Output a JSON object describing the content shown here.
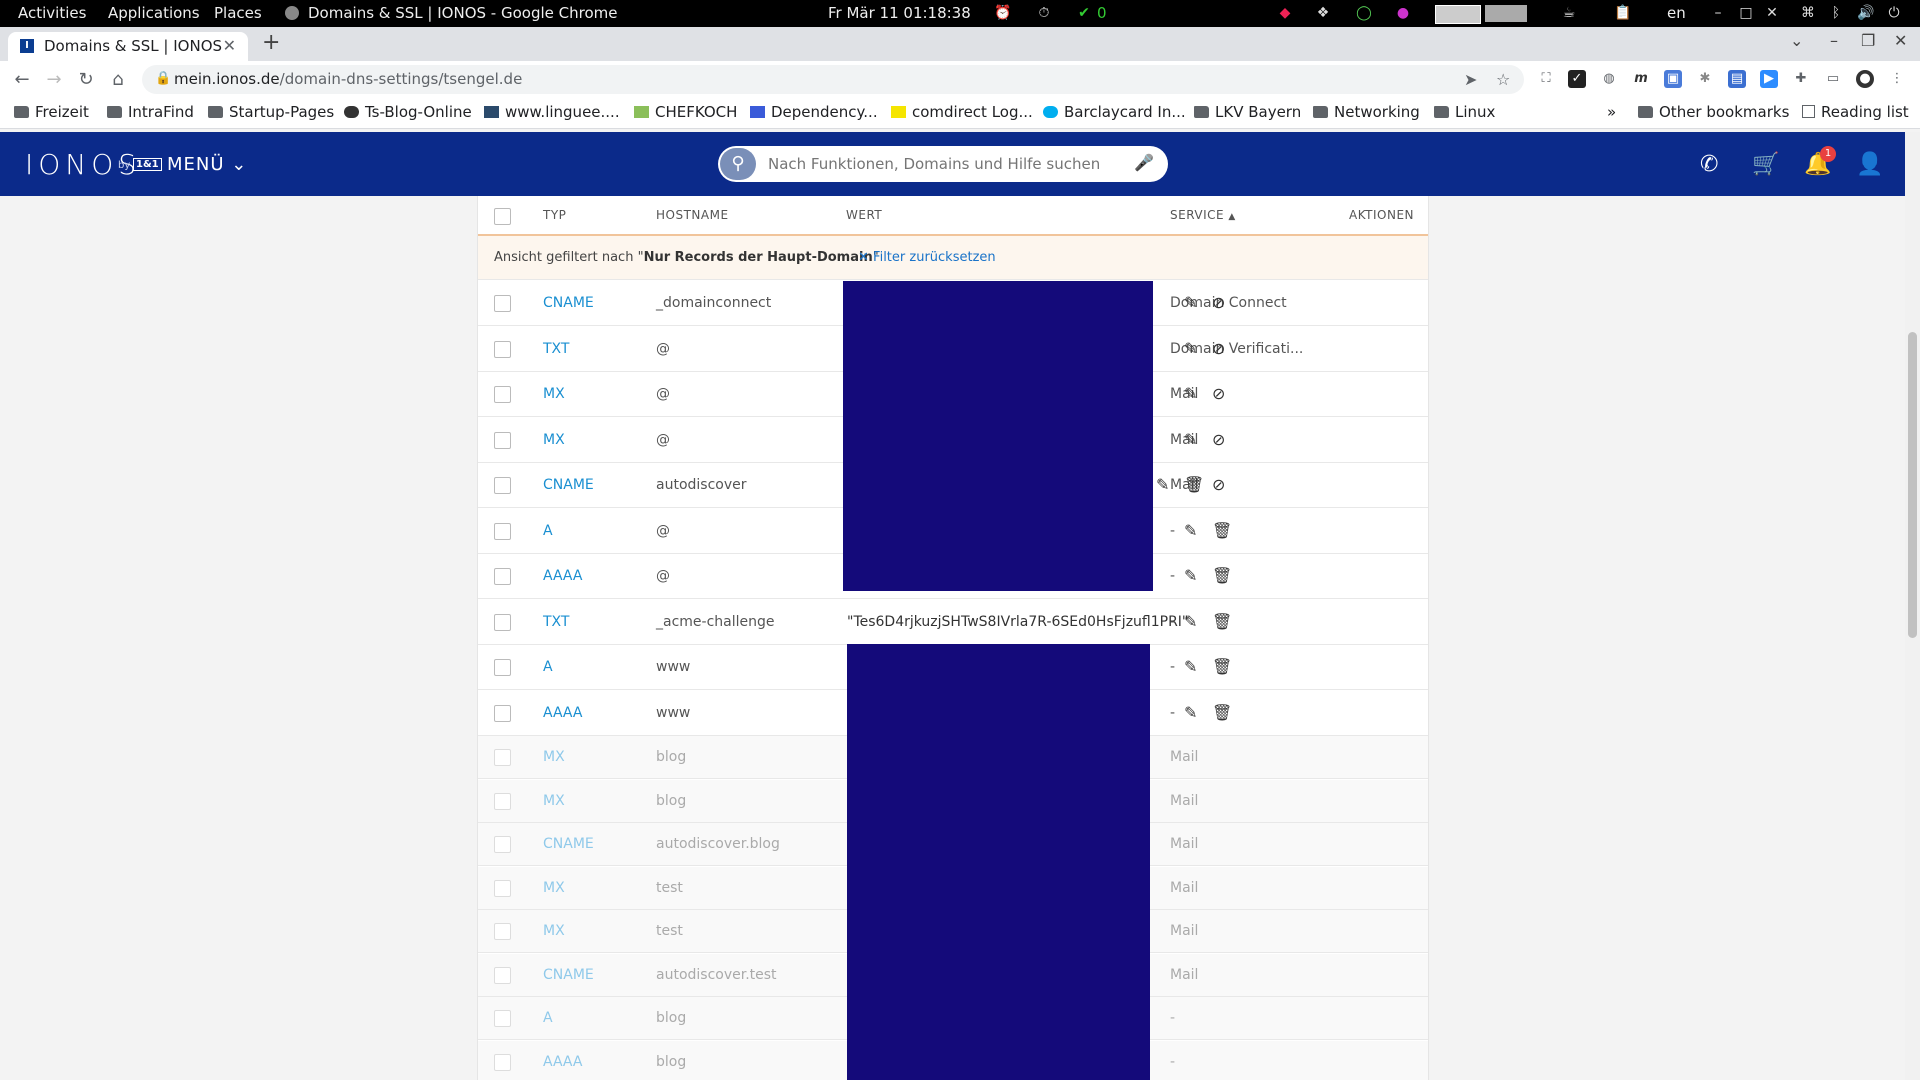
{
  "system_bar": {
    "activities": "Activities",
    "applications": "Applications",
    "places": "Places",
    "window_title": "Domains & SSL | IONOS - Google Chrome",
    "clock": "Fr Mär 11  01:18:38",
    "check_count": "0",
    "language": "en"
  },
  "browser": {
    "tab_title": "Domains & SSL | IONOS",
    "url_host": "mein.ionos.de",
    "url_path": "/domain-dns-settings/tsengel.de"
  },
  "bookmarks": [
    {
      "label": "Freizeit",
      "icon": "folder-icon"
    },
    {
      "label": "IntraFind",
      "icon": "folder-icon"
    },
    {
      "label": "Startup-Pages",
      "icon": "folder-icon"
    },
    {
      "label": "Ts-Blog-Online",
      "icon": "blog-icon"
    },
    {
      "label": "www.linguee....",
      "icon": "linguee-icon"
    },
    {
      "label": "CHEFKOCH",
      "icon": "chefkoch-icon"
    },
    {
      "label": "Dependency...",
      "icon": "dependency-icon"
    },
    {
      "label": "comdirect Log...",
      "icon": "comdirect-icon"
    },
    {
      "label": "Barclaycard In...",
      "icon": "barclaycard-icon"
    },
    {
      "label": "LKV Bayern",
      "icon": "folder-icon"
    },
    {
      "label": "Networking",
      "icon": "folder-icon"
    },
    {
      "label": "Linux",
      "icon": "folder-icon"
    }
  ],
  "bookmarks_overflow": "»",
  "other_bookmarks": "Other bookmarks",
  "reading_list": "Reading list",
  "ionos": {
    "logo": "IONOS",
    "logo_by": "by",
    "logo_brand": "1&1",
    "menu_label": "MENÜ",
    "search_placeholder": "Nach Funktionen, Domains und Hilfe suchen",
    "notification_count": "1",
    "brand_color": "#0b2a8a"
  },
  "table": {
    "headers": {
      "typ": "TYP",
      "hostname": "HOSTNAME",
      "wert": "WERT",
      "service": "SERVICE",
      "sort_indicator": "▲",
      "aktionen": "AKTIONEN"
    },
    "filter_prefix": "Ansicht gefiltert nach \"",
    "filter_name": "Nur Records der Haupt-Domain",
    "filter_suffix": "\"",
    "filter_reset": "Filter zurücksetzen",
    "rows": [
      {
        "typ": "CNAME",
        "host": "_domainconnect",
        "wert": "",
        "service": "Domain Connect",
        "actions": [
          "edit",
          "disable"
        ],
        "active": true
      },
      {
        "typ": "TXT",
        "host": "@",
        "wert": "",
        "service": "Domain Verificati...",
        "actions": [
          "edit",
          "disable"
        ],
        "active": true
      },
      {
        "typ": "MX",
        "host": "@",
        "wert": "",
        "service": "Mail",
        "actions": [
          "edit",
          "disable"
        ],
        "active": true
      },
      {
        "typ": "MX",
        "host": "@",
        "wert": "",
        "service": "Mail",
        "actions": [
          "edit",
          "disable"
        ],
        "active": true
      },
      {
        "typ": "CNAME",
        "host": "autodiscover",
        "wert": "",
        "service": "Mail",
        "actions": [
          "edit",
          "delete",
          "disable"
        ],
        "active": true
      },
      {
        "typ": "A",
        "host": "@",
        "wert": "",
        "service": "-",
        "actions": [
          "edit",
          "delete"
        ],
        "active": true
      },
      {
        "typ": "AAAA",
        "host": "@",
        "wert": "",
        "service": "-",
        "actions": [
          "edit",
          "delete"
        ],
        "active": true
      },
      {
        "typ": "TXT",
        "host": "_acme-challenge",
        "wert": "\"Tes6D4rjkuzjSHTwS8IVrla7R-6SEd0HsFjzufl1PRI\"",
        "service": "-",
        "actions": [
          "edit",
          "delete"
        ],
        "active": true
      },
      {
        "typ": "A",
        "host": "www",
        "wert": "",
        "service": "-",
        "actions": [
          "edit",
          "delete"
        ],
        "active": true
      },
      {
        "typ": "AAAA",
        "host": "www",
        "wert": "",
        "service": "-",
        "actions": [
          "edit",
          "delete"
        ],
        "active": true
      },
      {
        "typ": "MX",
        "host": "blog",
        "wert": "",
        "service": "Mail",
        "actions": [],
        "active": false
      },
      {
        "typ": "MX",
        "host": "blog",
        "wert": "",
        "service": "Mail",
        "actions": [],
        "active": false
      },
      {
        "typ": "CNAME",
        "host": "autodiscover.blog",
        "wert": "",
        "service": "Mail",
        "actions": [],
        "active": false
      },
      {
        "typ": "MX",
        "host": "test",
        "wert": "",
        "service": "Mail",
        "actions": [],
        "active": false
      },
      {
        "typ": "MX",
        "host": "test",
        "wert": "",
        "service": "Mail",
        "actions": [],
        "active": false
      },
      {
        "typ": "CNAME",
        "host": "autodiscover.test",
        "wert": "",
        "service": "Mail",
        "actions": [],
        "active": false
      },
      {
        "typ": "A",
        "host": "blog",
        "wert": "",
        "service": "-",
        "actions": [],
        "active": false
      },
      {
        "typ": "AAAA",
        "host": "blog",
        "wert": "",
        "service": "-",
        "actions": [],
        "active": false
      }
    ]
  },
  "colors": {
    "link_blue": "#1a8fd1",
    "redaction": "#140a7a",
    "header_underline": "#f1c49a"
  }
}
